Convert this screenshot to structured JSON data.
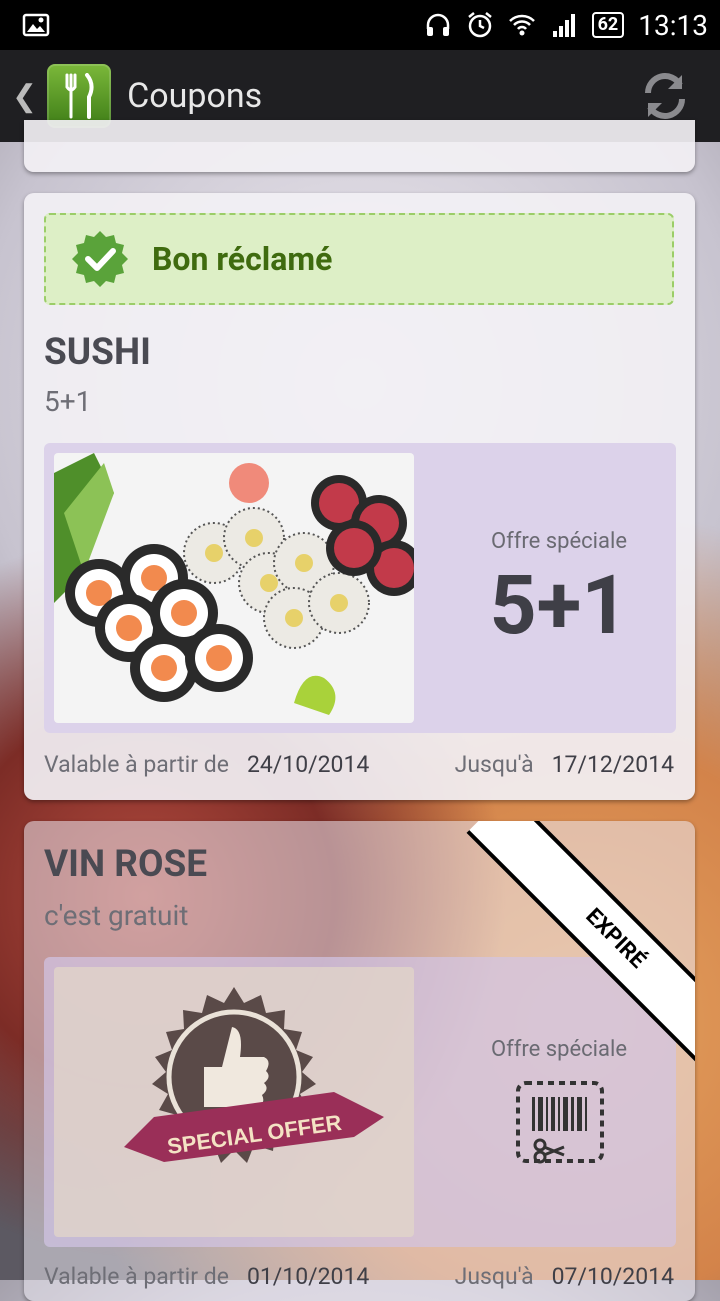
{
  "status_bar": {
    "battery": "62",
    "time": "13:13"
  },
  "action_bar": {
    "title": "Coupons"
  },
  "coupons": [
    {
      "claimed_label": "Bon réclamé",
      "title": "SUSHI",
      "subtitle": "5+1",
      "offer_label": "Offre spéciale",
      "offer_value": "5+1",
      "valid_from_label": "Valable à partir de",
      "valid_from": "24/10/2014",
      "valid_until_label": "Jusqu'à",
      "valid_until": "17/12/2014"
    },
    {
      "badge": "EXPIRÉ",
      "title": "VIN ROSE",
      "subtitle": "c'est gratuit",
      "offer_label": "Offre spéciale",
      "image_text": "SPECIAL OFFER",
      "valid_from_label": "Valable à partir de",
      "valid_from": "01/10/2014",
      "valid_until_label": "Jusqu'à",
      "valid_until": "07/10/2014"
    }
  ]
}
